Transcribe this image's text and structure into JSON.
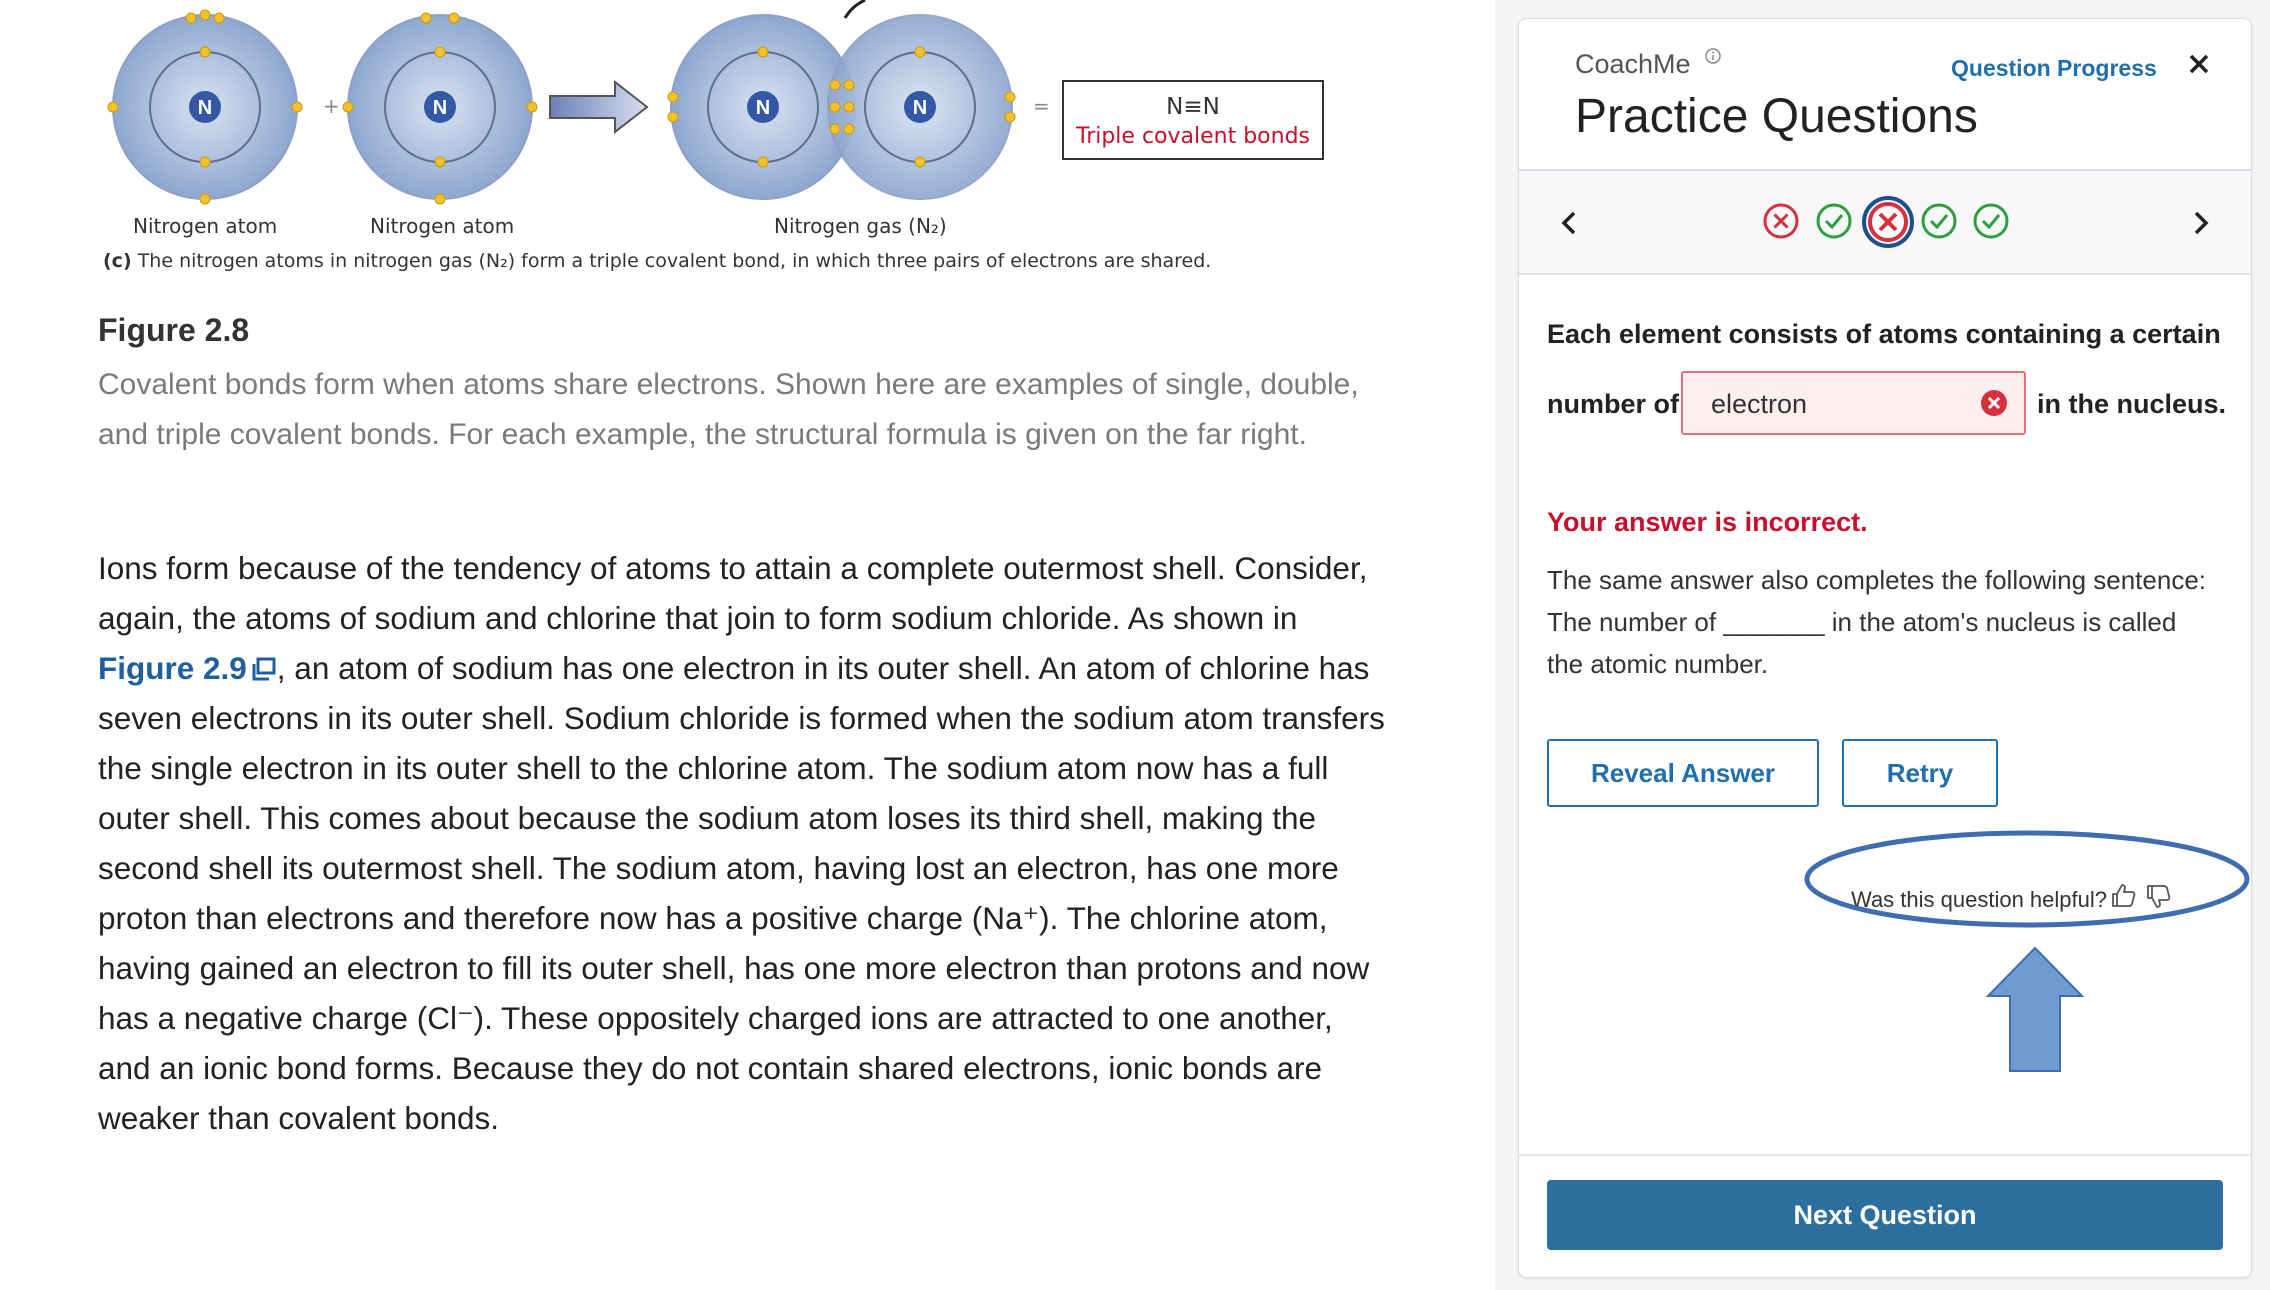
{
  "figure": {
    "formula": "N≡N",
    "formula_caption": "Triple covalent bonds",
    "atom_symbol": "N",
    "labels": [
      "Nitrogen atom",
      "Nitrogen atom",
      "Nitrogen gas (N₂)"
    ],
    "plus_sign": "+",
    "equals_sign": "=",
    "caption_letter": "(c)",
    "caption_text": "The nitrogen atoms in nitrogen gas (N₂) form a triple covalent bond, in which three pairs of electrons are shared.",
    "title": "Figure 2.8",
    "description": "Covalent bonds form when atoms share electrons. Shown here are examples of single, double, and triple covalent bonds. For each example, the structural formula is given on the far right."
  },
  "body": {
    "part1": "Ions form because of the tendency of atoms to attain a complete outermost shell. Consider, again, the atoms of sodium and chlorine that join to form sodium chloride. As shown in ",
    "link": "Figure 2.9",
    "part2": ", an atom of sodium has one electron in its outer shell. An atom of chlorine has seven electrons in its outer shell. Sodium chloride is formed when the sodium atom transfers the single electron in its outer shell to the chlorine atom. The sodium atom now has a full outer shell. This comes about because the sodium atom loses its third shell, making the second shell its outermost shell. The sodium atom, having lost an electron, has one more proton than electrons and therefore now has a positive charge (Na⁺). The chlorine atom, having gained an electron to fill its outer shell, has one more electron than protons and now has a negative charge (Cl⁻). These oppositely charged ions are attracted to one another, and an ionic bond forms. Because they do not contain shared electrons, ionic bonds are weaker than covalent bonds."
  },
  "panel": {
    "brand": "CoachMe",
    "progress_link": "Question Progress",
    "title": "Practice Questions",
    "question_statuses": [
      "incorrect",
      "correct",
      "incorrect-current",
      "correct",
      "correct"
    ],
    "question_line1": "Each element consists of atoms containing a certain",
    "question_prefix": "number of",
    "answer_value": "electron",
    "question_suffix": "in the nucleus.",
    "feedback_title": "Your answer is incorrect.",
    "feedback_body": "The same answer also completes the following sentence: The number of _______ in the atom's nucleus is called the atomic number.",
    "reveal_label": "Reveal Answer",
    "retry_label": "Retry",
    "helpful_label": "Was this question helpful?",
    "next_label": "Next Question",
    "colors": {
      "accent": "#1f6fae",
      "error": "#c8102e",
      "correct": "#2e9e3e",
      "primary_button": "#2c6e9e"
    }
  }
}
